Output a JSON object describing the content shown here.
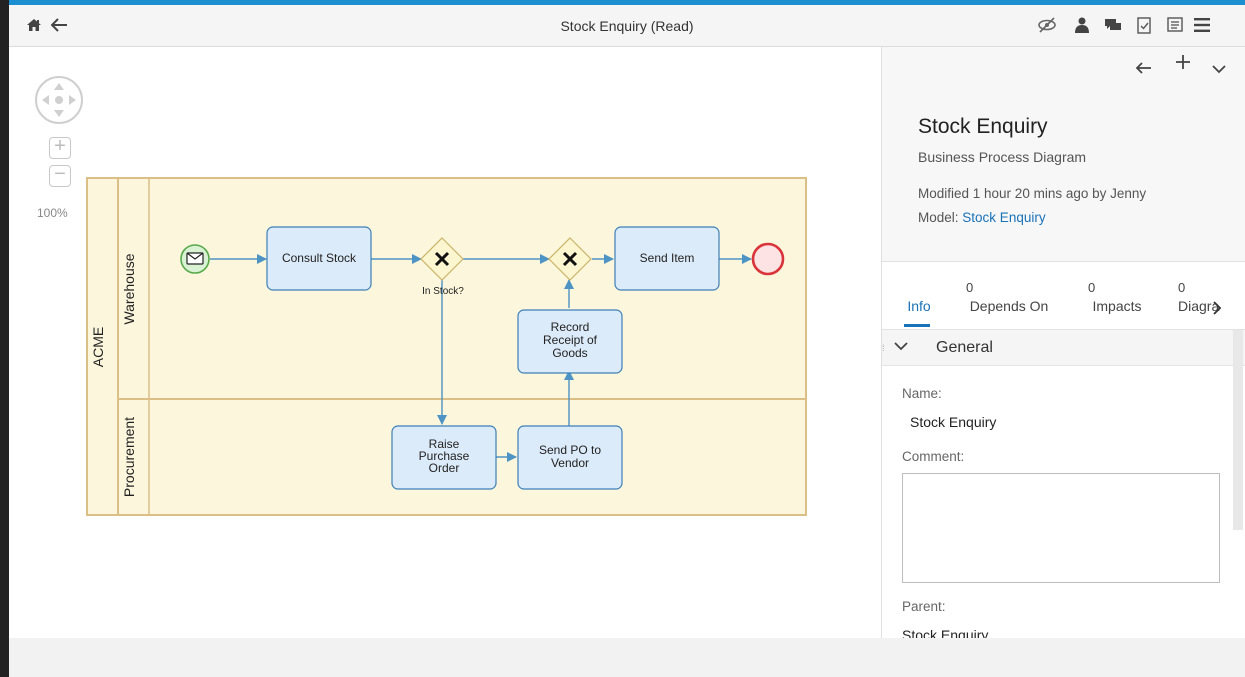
{
  "toolbar": {
    "title": "Stock Enquiry (Read)",
    "left_icons": [
      "home-icon",
      "back-arrow-icon"
    ],
    "right_icons": [
      "visibility-off-icon",
      "user-icon",
      "comments-icon",
      "checklist-icon",
      "details-icon",
      "menu-icon"
    ]
  },
  "canvas": {
    "zoom_level": "100%"
  },
  "diagram": {
    "pool_label": "ACME",
    "lanes": [
      "Warehouse",
      "Procurement"
    ],
    "tasks": {
      "consult_stock": "Consult Stock",
      "send_item": "Send Item",
      "record_receipt": [
        "Record",
        "Receipt of",
        "Goods"
      ],
      "raise_po": [
        "Raise",
        "Purchase",
        "Order"
      ],
      "send_po": [
        "Send PO to",
        "Vendor"
      ]
    },
    "gateway_label": "In Stock?",
    "colors": {
      "task_fill": "#dcebf9",
      "task_stroke": "#3d7fb8",
      "pool_fill": "#fbf6dc",
      "pool_stroke": "#dbbf86",
      "gateway_fill": "#fbf6cf",
      "start_fill": "#d9f2d4",
      "start_stroke": "#57a94a",
      "end_fill": "#fde3e3",
      "end_stroke": "#d9343a",
      "flow": "#4d93c3"
    }
  },
  "panel": {
    "title": "Stock Enquiry",
    "subtitle": "Business Process Diagram",
    "modified": "Modified 1 hour 20 mins ago by Jenny",
    "model_label": "Model:",
    "model_link": "Stock Enquiry",
    "tabs": [
      {
        "count": "",
        "label": "Info"
      },
      {
        "count": "0",
        "label": "Depends On"
      },
      {
        "count": "0",
        "label": "Impacts"
      },
      {
        "count": "0",
        "label": "Diagra"
      }
    ],
    "section_title": "General",
    "name_label": "Name:",
    "name_value": "Stock Enquiry",
    "comment_label": "Comment:",
    "parent_label": "Parent:",
    "parent_link": "Stock Enquiry"
  }
}
